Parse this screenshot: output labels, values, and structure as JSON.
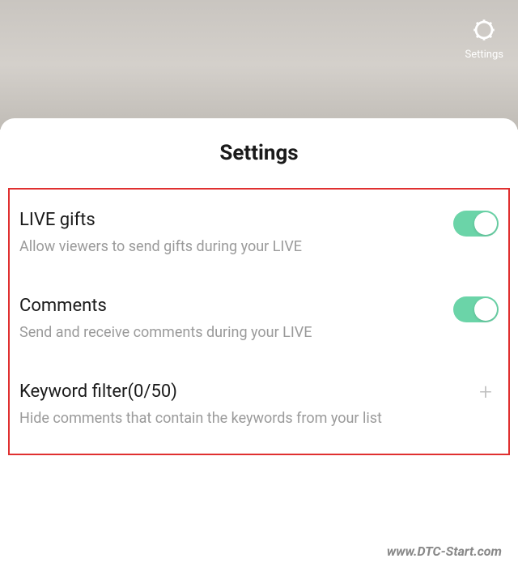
{
  "header": {
    "settings_button_label": "Settings"
  },
  "panel": {
    "title": "Settings"
  },
  "settings": {
    "live_gifts": {
      "label": "LIVE gifts",
      "description": "Allow viewers to send gifts during your LIVE",
      "enabled": true
    },
    "comments": {
      "label": "Comments",
      "description": "Send and receive comments during your LIVE",
      "enabled": true
    },
    "keyword_filter": {
      "label": "Keyword filter(0/50)",
      "description": "Hide comments that contain the keywords from your list"
    }
  },
  "watermark": "www.DTC-Start.com"
}
